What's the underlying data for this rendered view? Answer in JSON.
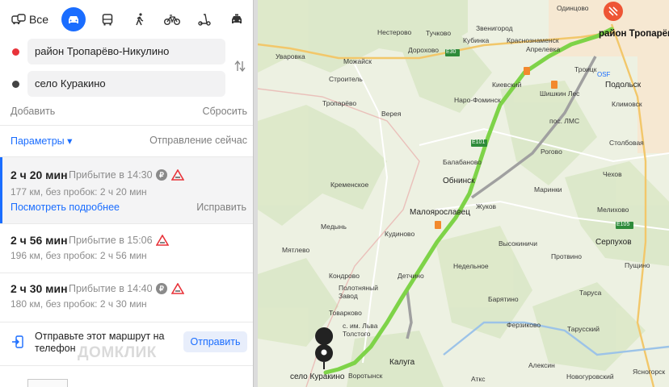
{
  "modes": {
    "all_label": "Все",
    "items": [
      "car-icon",
      "bus-icon",
      "walk-icon",
      "bicycle-icon",
      "scooter-icon",
      "taxi-icon"
    ]
  },
  "points": {
    "from": "район Тропарёво-Никулино",
    "to": "село Куракино"
  },
  "actions": {
    "add": "Добавить",
    "reset": "Сбросить"
  },
  "options": {
    "params": "Параметры ▾",
    "depart": "Отправление сейчас"
  },
  "routes": [
    {
      "time": "2 ч 20 мин",
      "arrival": "Прибытие в 14:30",
      "info": "177 км, без пробок: 2 ч 20 мин",
      "parking": true,
      "warning": true,
      "more": "Посмотреть подробнее",
      "fix": "Исправить"
    },
    {
      "time": "2 ч 56 мин",
      "arrival": "Прибытие в 15:06",
      "info": "196 км, без пробок: 2 ч 56 мин",
      "parking": false,
      "warning": true
    },
    {
      "time": "2 ч 30 мин",
      "arrival": "Прибытие в 14:40",
      "info": "180 км, без пробок: 2 ч 30 мин",
      "parking": true,
      "warning": true
    }
  ],
  "send": {
    "text": "Отправьте этот маршрут на телефон",
    "button": "Отправить"
  },
  "watermark": "ДОМКЛИК",
  "map": {
    "start_label": "район Тропарёво-Никулино",
    "end_label": "село Куракино",
    "places": {
      "odintsovo": "Одинцово",
      "nesterovo": "Нестерово",
      "tuchkovo": "Тучково",
      "zvenigorod": "Звенигород",
      "uvarovka": "Уваровка",
      "kubinka": "Кубинка",
      "krasnoznamensk": "Краснознаменск",
      "mozhaysk": "Можайск",
      "dorokhovo": "Дорохово",
      "aprelevka": "Апрелевка",
      "stroitel": "Строитель",
      "kievsky": "Киевский",
      "shishkin_les": "Шишкин Лес",
      "troitsk": "Троицк",
      "podolsk": "Подольск",
      "tropar": "Тропарёво",
      "vereya": "Верея",
      "naro_fominsk": "Наро-Фоминск",
      "klimovsk": "Климовск",
      "lms": "пос. ЛМС",
      "stolbovaya": "Столбовая",
      "balabanovo": "Балабаново",
      "rogovo": "Рогово",
      "chekhov": "Чехов",
      "kremenskoe": "Кременское",
      "obninsk": "Обнинск",
      "marinki": "Маринки",
      "maloyaroslavets": "Малоярославец",
      "zhukov": "Жуков",
      "melikhovo": "Мелихово",
      "medyn": "Медынь",
      "kudinovo": "Кудиново",
      "serpukhov": "Серпухов",
      "myatlevo": "Мятлево",
      "vysokinichi": "Высокиничи",
      "protvino": "Протвино",
      "kondrovo": "Кондрово",
      "detchino": "Детчино",
      "nedelnoe": "Недельное",
      "pushchino": "Пущино",
      "polotnyany": "Полотняный Завод",
      "tovarkovo": "Товарково",
      "tarusa": "Таруса",
      "barytino": "Барятино",
      "lvа": "с. им. Льва Толстого",
      "ferzikovo": "Ферзиково",
      "tarusa2": "Тарусский",
      "kaluga": "Калуга",
      "vorotynsk": "Воротынск",
      "aleksin": "Алексин",
      "novogurovsky": "Новогуровский",
      "yasnogorsk": "Ясногорск",
      "ateks": "Аткс",
      "e30": "E30",
      "e101": "E101",
      "e105": "E105",
      "osf": "OSF"
    }
  },
  "colors": {
    "accent": "#1a6dff",
    "route_main": "#7ed348",
    "route_alt": "#a0a0a0",
    "start_pin": "#ee5535",
    "end_pin": "#222222",
    "from_dot": "#e8333a",
    "to_dot": "#444444"
  }
}
